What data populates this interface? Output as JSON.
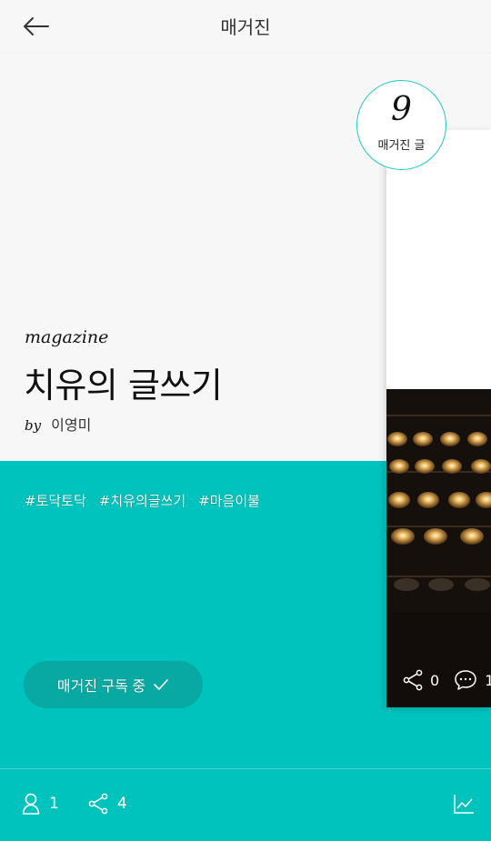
{
  "header": {
    "title": "매거진"
  },
  "magazine": {
    "label": "magazine",
    "title": "치유의 글쓰기",
    "by_label": "by",
    "author": "이영미",
    "tags": [
      "#토닥토닥",
      "#치유의글쓰기",
      "#마음이불"
    ],
    "subscribe_label": "매거진 구독 중"
  },
  "badge": {
    "count": "9",
    "label": "매거진 글"
  },
  "card": {
    "shares": "0",
    "comments": "1"
  },
  "footer": {
    "subscribers": "1",
    "shares": "4"
  },
  "colors": {
    "accent": "#00c3bd",
    "button": "#08a9a3",
    "background": "#f7f7f7"
  }
}
